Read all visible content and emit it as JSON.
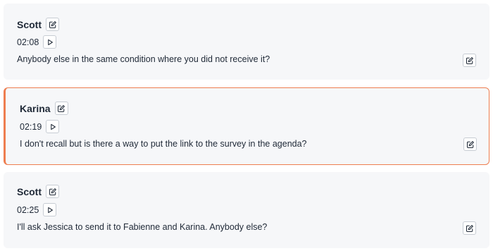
{
  "entries": [
    {
      "speaker": "Scott",
      "time": "02:08",
      "text": "Anybody else in the same condition where you did not receive it?",
      "active": false
    },
    {
      "speaker": "Karina",
      "time": "02:19",
      "text": "I don't recall but is there a way to put the link to the survey in the agenda?",
      "active": true
    },
    {
      "speaker": "Scott",
      "time": "02:25",
      "text": "I'll ask Jessica to send it to Fabienne and Karina. Anybody else?",
      "active": false
    }
  ],
  "colors": {
    "active_border": "#ee7d4f",
    "card_bg": "#f6f7f9"
  },
  "icons": {
    "edit": "pencil-square-icon",
    "play": "play-triangle-icon"
  }
}
